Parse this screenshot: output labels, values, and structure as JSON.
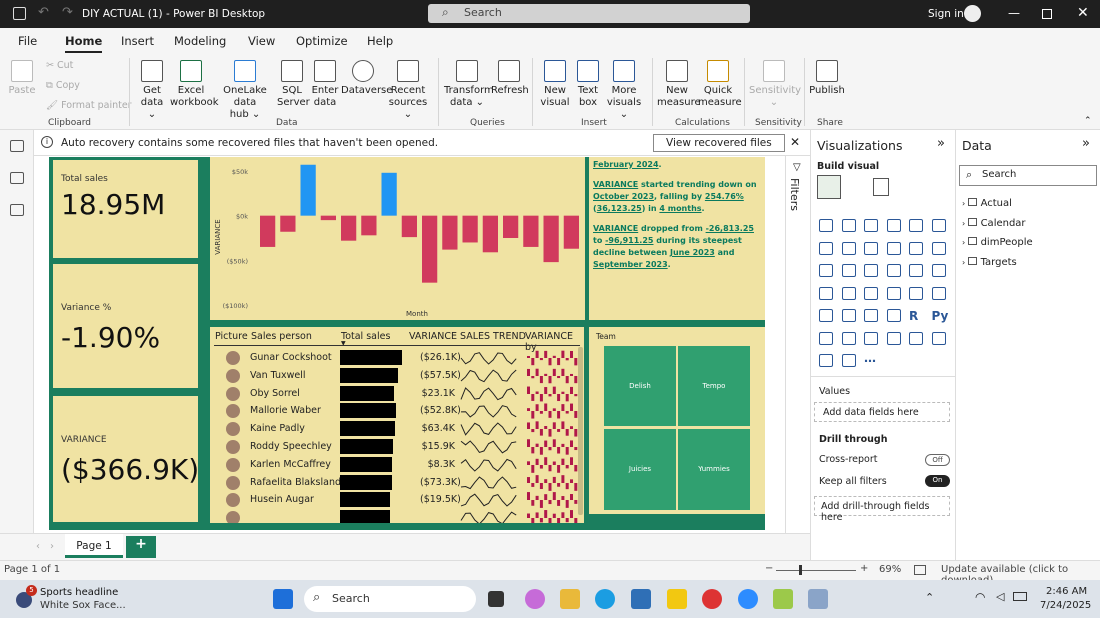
{
  "titlebar": {
    "title": "DIY ACTUAL (1) - Power BI Desktop",
    "search": "Search",
    "signin": "Sign in"
  },
  "menu": [
    "File",
    "Home",
    "Insert",
    "Modeling",
    "View",
    "Optimize",
    "Help"
  ],
  "ribbon": {
    "clipboard": {
      "paste": "Paste",
      "cut": "Cut",
      "copy": "Copy",
      "format": "Format painter",
      "group": "Clipboard"
    },
    "data": {
      "items": [
        [
          "Get",
          "data ⌄"
        ],
        [
          "Excel",
          "workbook"
        ],
        [
          "OneLake data",
          "hub ⌄"
        ],
        [
          "SQL",
          "Server"
        ],
        [
          "Enter",
          "data"
        ],
        [
          "Dataverse",
          ""
        ],
        [
          "Recent",
          "sources ⌄"
        ]
      ],
      "group": "Data"
    },
    "queries": {
      "items": [
        [
          "Transform",
          "data ⌄"
        ],
        [
          "Refresh",
          ""
        ]
      ],
      "group": "Queries"
    },
    "insert": {
      "items": [
        [
          "New",
          "visual"
        ],
        [
          "Text",
          "box"
        ],
        [
          "More",
          "visuals ⌄"
        ]
      ],
      "group": "Insert"
    },
    "calculations": {
      "items": [
        [
          "New",
          "measure"
        ],
        [
          "Quick",
          "measure"
        ]
      ],
      "group": "Calculations"
    },
    "sensitivity": {
      "items": [
        [
          "Sensitivity",
          "⌄"
        ]
      ],
      "group": "Sensitivity"
    },
    "share": {
      "items": [
        [
          "Publish",
          ""
        ]
      ],
      "group": "Share"
    }
  },
  "info": {
    "text": "Auto recovery contains some recovered files that haven't been opened.",
    "button": "View recovered files"
  },
  "cards": [
    {
      "label": "Total sales",
      "value": "18.95M"
    },
    {
      "label": "Variance %",
      "value": "-1.90%"
    },
    {
      "label": "VARIANCE",
      "value": "($366.9K)"
    }
  ],
  "chart_data": {
    "type": "bar",
    "ylabel": "VARIANCE",
    "xlabel": "Month",
    "yticks": [
      "$50k",
      "$0k",
      "($50k)",
      "($100k)"
    ],
    "ylim": [
      -100,
      50
    ],
    "values": [
      -35,
      -18,
      57,
      -5,
      -28,
      -22,
      48,
      -24,
      -75,
      -38,
      -30,
      -41,
      -25,
      -35,
      -52,
      -37
    ]
  },
  "narrative": [
    {
      "parts": [
        "February 2024",
        "."
      ]
    },
    {
      "parts": [
        "VARIANCE",
        " started trending down on ",
        "October 2023",
        ", falling by ",
        "254.76%",
        " (",
        "36,123.25",
        ") in ",
        "4 months",
        "."
      ]
    },
    {
      "parts": [
        "VARIANCE",
        " dropped from ",
        "-26,813.25",
        " to ",
        "-96,911.25",
        " during its steepest decline between ",
        "June 2023",
        " and ",
        "September 2023",
        "."
      ]
    }
  ],
  "table": {
    "headers": [
      "Picture",
      "Sales person",
      "Total sales",
      "VARIANCE",
      "SALES TREND",
      "VARIANCE by"
    ],
    "rows": [
      {
        "name": "Gunar Cockshoot",
        "variance": "($26.1K)",
        "w": 62
      },
      {
        "name": "Van Tuxwell",
        "variance": "($57.5K)",
        "w": 58
      },
      {
        "name": "Oby Sorrel",
        "variance": "$23.1K",
        "w": 54
      },
      {
        "name": "Mallorie Waber",
        "variance": "($52.8K)",
        "w": 56
      },
      {
        "name": "Kaine Padly",
        "variance": "$63.4K",
        "w": 55
      },
      {
        "name": "Roddy Speechley",
        "variance": "$15.9K",
        "w": 53
      },
      {
        "name": "Karlen McCaffrey",
        "variance": "$8.3K",
        "w": 52
      },
      {
        "name": "Rafaelita Blaksland",
        "variance": "($73.3K)",
        "w": 52
      },
      {
        "name": "Husein Augar",
        "variance": "($19.5K)",
        "w": 50
      },
      {
        "name": "",
        "variance": "",
        "w": 50
      }
    ]
  },
  "treemap": {
    "title": "Team",
    "tiles": [
      "Delish",
      "Tempo",
      "Juicies",
      "Yummies"
    ]
  },
  "pages": {
    "page1": "Page 1",
    "add": "+",
    "status": "Page 1 of 1",
    "zoom": "69%",
    "update": "Update available (click to download)"
  },
  "filters": "Filters",
  "viz": {
    "title": "Visualizations",
    "build": "Build visual",
    "values": "Values",
    "add_fields": "Add data fields here",
    "drill": "Drill through",
    "cross": "Cross-report",
    "cross_state": "Off",
    "keep": "Keep all filters",
    "keep_state": "On",
    "drill_add": "Add drill-through fields here"
  },
  "data": {
    "title": "Data",
    "search": "Search",
    "tables": [
      "Actual",
      "Calendar",
      "dimPeople",
      "Targets"
    ]
  },
  "taskbar": {
    "news_title": "Sports headline",
    "news_sub": "White Sox Face...",
    "badge": "5",
    "search": "Search",
    "time": "2:46 AM",
    "date": "7/24/2025"
  },
  "colors": {
    "theme_green": "#1b7e5e",
    "card_bg": "#f0e3a3",
    "neg_bar": "#d13a5d",
    "pos_bar": "#2196f3"
  }
}
